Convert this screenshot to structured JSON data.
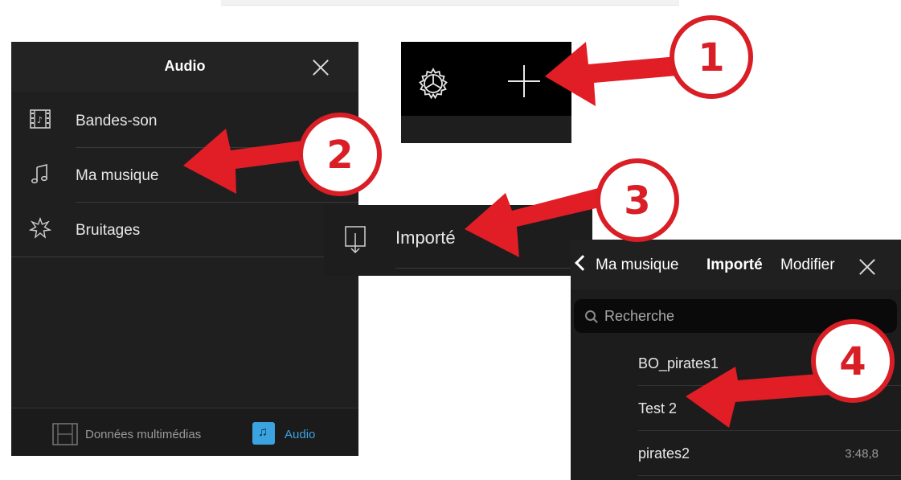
{
  "audio_panel": {
    "title": "Audio",
    "items": [
      {
        "label": "Bandes-son",
        "icon": "film-music-icon"
      },
      {
        "label": "Ma musique",
        "icon": "music-note-icon"
      },
      {
        "label": "Bruitages",
        "icon": "starburst-icon"
      }
    ],
    "footer": {
      "media_label": "Données multimédias",
      "audio_label": "Audio"
    }
  },
  "toolbar_panel": {
    "icons": [
      "gear-icon",
      "plus-icon"
    ]
  },
  "importe_panel": {
    "label": "Importé",
    "icon": "import-icon"
  },
  "list_panel": {
    "back_label": "Ma musique",
    "title": "Importé",
    "edit_label": "Modifier",
    "search_placeholder": "Recherche",
    "rows": [
      {
        "title": "BO_pirates1",
        "duration": ""
      },
      {
        "title": "Test 2",
        "duration": ""
      },
      {
        "title": "pirates2",
        "duration": "3:48,8"
      }
    ]
  },
  "callouts": [
    "1",
    "2",
    "3",
    "4"
  ],
  "colors": {
    "accent_blue": "#3aa3e0",
    "callout_red": "#d91e26",
    "panel_dark": "#1f1f1f"
  }
}
